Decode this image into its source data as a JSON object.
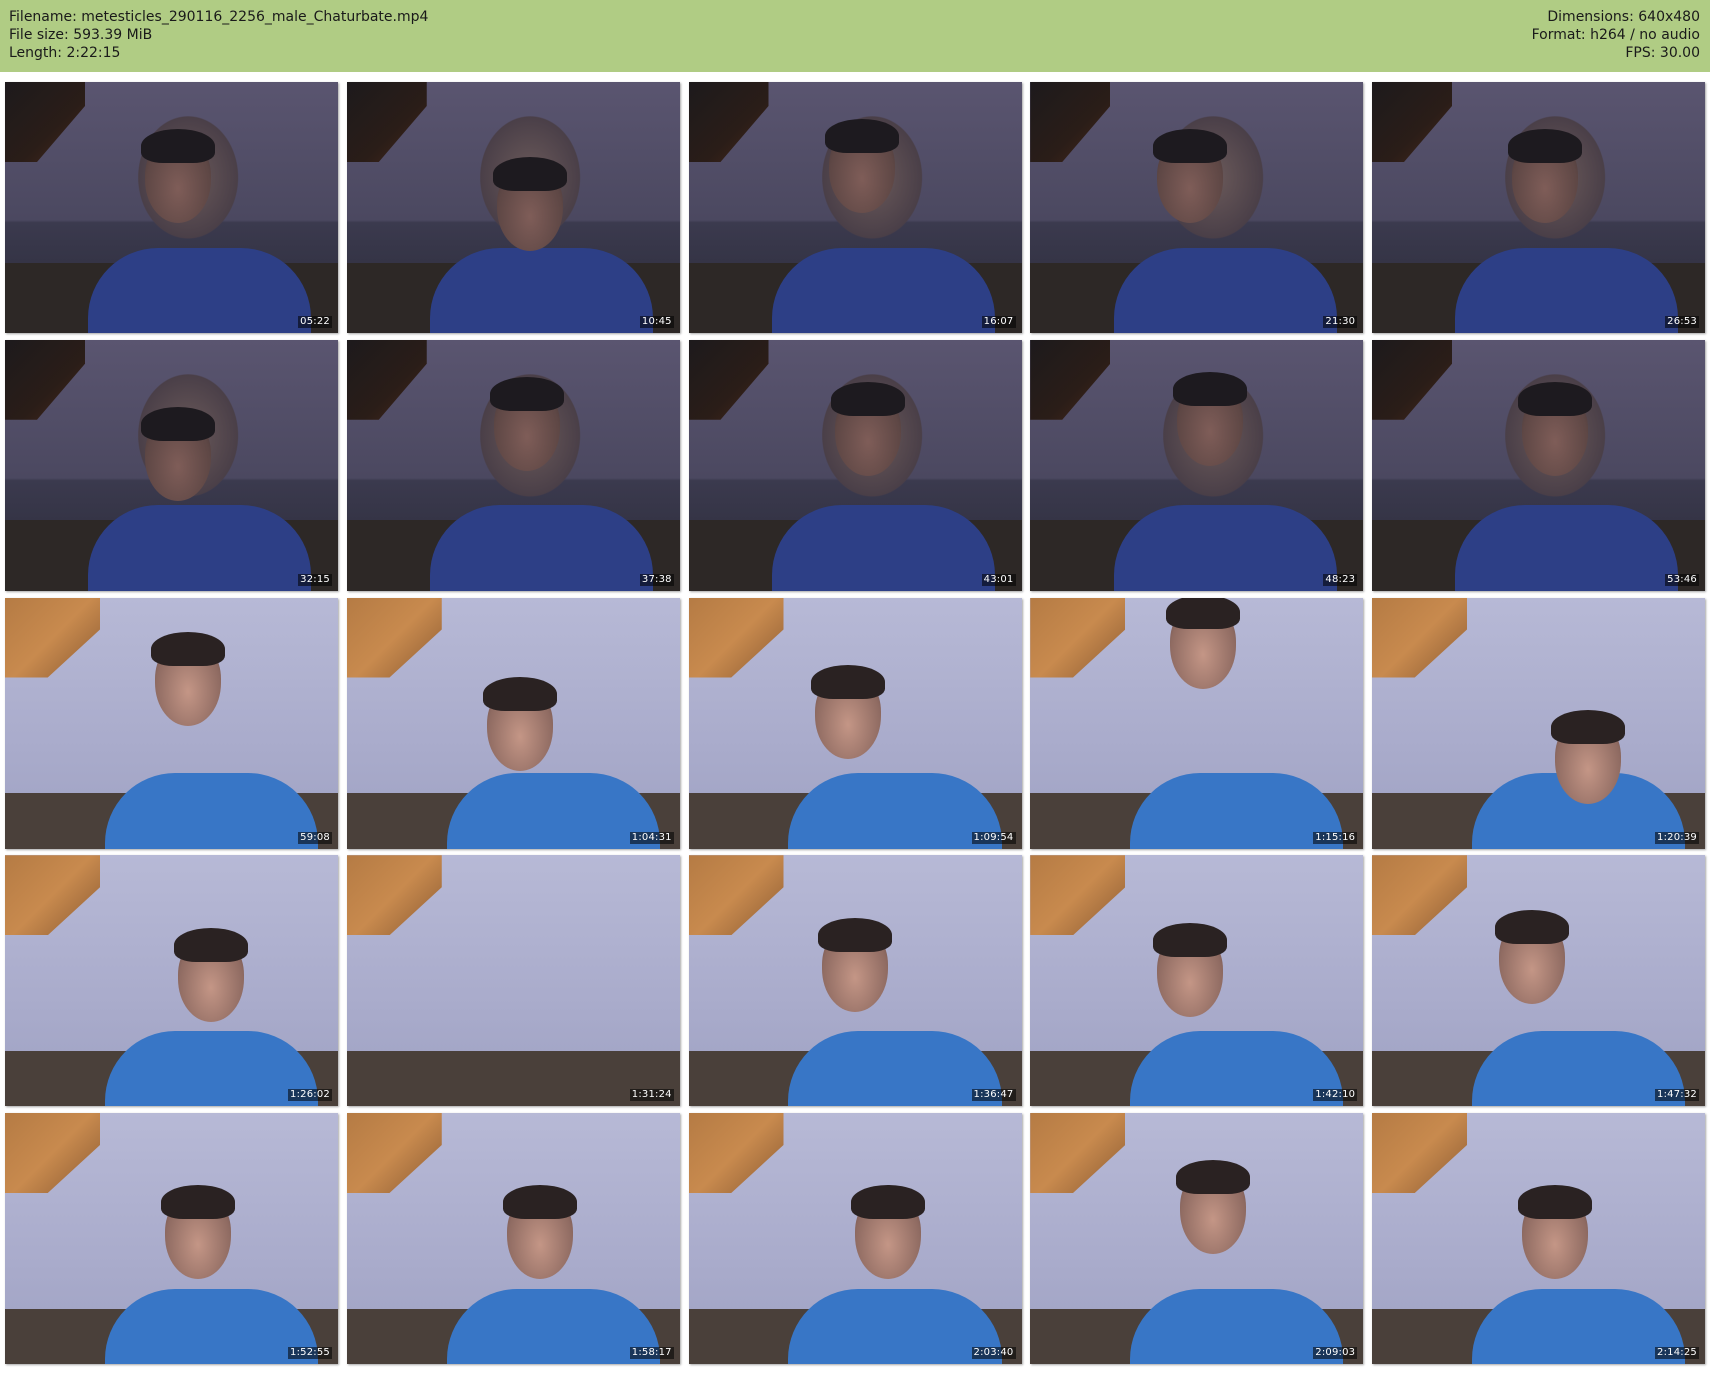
{
  "header": {
    "filename": "Filename: metesticles_290116_2256_male_Chaturbate.mp4",
    "file_size": "File size: 593.39 MiB",
    "length": "Length: 2:22:15",
    "dimensions": "Dimensions: 640x480",
    "format": "Format: h264 / no audio",
    "fps": "FPS: 30.00"
  },
  "colors": {
    "header_background": "#b0cc84",
    "page_background": "#ffffff"
  },
  "thumbnails": [
    {
      "timestamp": "05:22",
      "scene": "dark"
    },
    {
      "timestamp": "10:45",
      "scene": "dark"
    },
    {
      "timestamp": "16:07",
      "scene": "dark"
    },
    {
      "timestamp": "21:30",
      "scene": "dark"
    },
    {
      "timestamp": "26:53",
      "scene": "dark"
    },
    {
      "timestamp": "32:15",
      "scene": "dark"
    },
    {
      "timestamp": "37:38",
      "scene": "dark"
    },
    {
      "timestamp": "43:01",
      "scene": "dark"
    },
    {
      "timestamp": "48:23",
      "scene": "dark"
    },
    {
      "timestamp": "53:46",
      "scene": "dark"
    },
    {
      "timestamp": "59:08",
      "scene": "light"
    },
    {
      "timestamp": "1:04:31",
      "scene": "light"
    },
    {
      "timestamp": "1:09:54",
      "scene": "light"
    },
    {
      "timestamp": "1:15:16",
      "scene": "light"
    },
    {
      "timestamp": "1:20:39",
      "scene": "light"
    },
    {
      "timestamp": "1:26:02",
      "scene": "light"
    },
    {
      "timestamp": "1:31:24",
      "scene": "light"
    },
    {
      "timestamp": "1:36:47",
      "scene": "light"
    },
    {
      "timestamp": "1:42:10",
      "scene": "light"
    },
    {
      "timestamp": "1:47:32",
      "scene": "light"
    },
    {
      "timestamp": "1:52:55",
      "scene": "light"
    },
    {
      "timestamp": "1:58:17",
      "scene": "light"
    },
    {
      "timestamp": "2:03:40",
      "scene": "light"
    },
    {
      "timestamp": "2:09:03",
      "scene": "light"
    },
    {
      "timestamp": "2:14:25",
      "scene": "light"
    }
  ]
}
